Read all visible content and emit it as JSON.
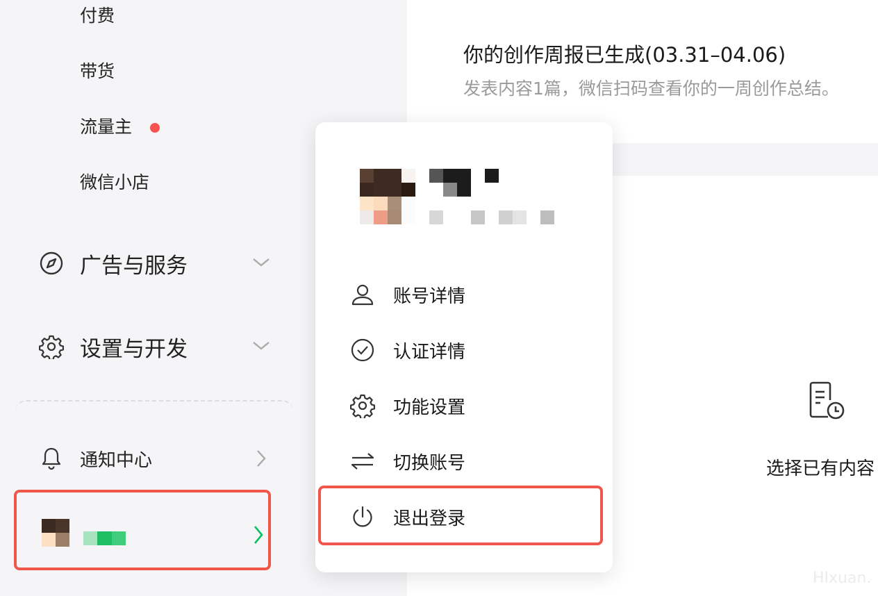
{
  "sidebar": {
    "sub_items": [
      "付费",
      "带货",
      "流量主",
      "微信小店"
    ],
    "groups": [
      {
        "label": "广告与服务",
        "icon": "compass-icon"
      },
      {
        "label": "设置与开发",
        "icon": "gear-icon"
      }
    ],
    "notice": {
      "label": "通知中心",
      "icon": "bell-icon"
    },
    "account": {
      "icon": "avatar",
      "chevron_color": "#07c160"
    }
  },
  "main": {
    "title": "你的创作周报已生成(03.31–04.06)",
    "subtitle": "发表内容1篇，微信扫码查看你的一周创作总结。",
    "select_text": "选择已有内容",
    "watermark": "HIxuan."
  },
  "dropdown": {
    "menu": [
      {
        "label": "账号详情",
        "icon": "user-icon"
      },
      {
        "label": "认证详情",
        "icon": "check-circle-icon"
      },
      {
        "label": "功能设置",
        "icon": "gear-icon"
      },
      {
        "label": "切换账号",
        "icon": "switch-icon"
      },
      {
        "label": "退出登录",
        "icon": "power-icon"
      }
    ]
  },
  "colors": {
    "accent_red": "#f0564a",
    "dot_red": "#fa5151",
    "brand_green": "#07c160",
    "sidebar_bg": "#f5f5f7"
  }
}
